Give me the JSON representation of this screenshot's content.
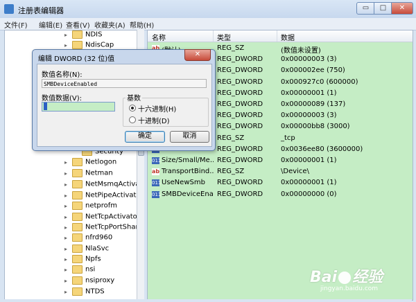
{
  "window": {
    "title": "注册表编辑器",
    "caption_buttons": {
      "minimize": "▭",
      "maximize": "□",
      "close": "✕"
    }
  },
  "menu": [
    "文件(F)",
    "编辑(E)",
    "查看(V)",
    "收藏夹(A)",
    "帮助(H)"
  ],
  "tree": {
    "items": [
      {
        "label": "NDIS",
        "expander": "▸"
      },
      {
        "label": "NdisCap",
        "expander": "▸"
      },
      {
        "label": "Security",
        "expander": ""
      },
      {
        "label": "Netlogon",
        "expander": "▸"
      },
      {
        "label": "Netman",
        "expander": "▸"
      },
      {
        "label": "NetMsmqActivato",
        "expander": "▸"
      },
      {
        "label": "NetPipeActivator",
        "expander": "▸"
      },
      {
        "label": "netprofm",
        "expander": "▸"
      },
      {
        "label": "NetTcpActivator",
        "expander": "▸"
      },
      {
        "label": "NetTcpPortSharin",
        "expander": "▸"
      },
      {
        "label": "nfrd960",
        "expander": "▸"
      },
      {
        "label": "NlaSvc",
        "expander": "▸"
      },
      {
        "label": "Npfs",
        "expander": "▸"
      },
      {
        "label": "nsi",
        "expander": "▸"
      },
      {
        "label": "nsiproxy",
        "expander": "▸"
      },
      {
        "label": "NTDS",
        "expander": "▸"
      }
    ]
  },
  "values_pane": {
    "headers": {
      "name": "名称",
      "type": "类型",
      "data": "数据"
    },
    "rows": [
      {
        "icon": "ab",
        "name": "(默认)",
        "type": "REG_SZ",
        "data": "(数值未设置)"
      },
      {
        "icon": "bin",
        "name": "",
        "type": "REG_DWORD",
        "data": "0x00000003 (3)"
      },
      {
        "icon": "bin",
        "name": "",
        "type": "REG_DWORD",
        "data": "0x000002ee (750)"
      },
      {
        "icon": "bin",
        "name": "",
        "type": "REG_DWORD",
        "data": "0x000927c0 (600000)"
      },
      {
        "icon": "bin",
        "name": "",
        "type": "REG_DWORD",
        "data": "0x00000001 (1)"
      },
      {
        "icon": "bin",
        "name": "",
        "type": "REG_DWORD",
        "data": "0x00000089 (137)"
      },
      {
        "icon": "bin",
        "name": "",
        "type": "REG_DWORD",
        "data": "0x00000003 (3)"
      },
      {
        "icon": "bin",
        "name": "",
        "type": "REG_DWORD",
        "data": "0x00000bb8 (3000)"
      },
      {
        "icon": "ab",
        "name": "",
        "type": "REG_SZ",
        "data": "_tcp"
      },
      {
        "icon": "bin",
        "name": "",
        "type": "REG_DWORD",
        "data": "0x0036ee80 (3600000)"
      },
      {
        "icon": "bin",
        "name": "Size/Small/Me...",
        "type": "REG_DWORD",
        "data": "0x00000001 (1)"
      },
      {
        "icon": "ab",
        "name": "TransportBind...",
        "type": "REG_SZ",
        "data": "\\Device\\"
      },
      {
        "icon": "bin",
        "name": "UseNewSmb",
        "type": "REG_DWORD",
        "data": "0x00000001 (1)"
      },
      {
        "icon": "bin",
        "name": "SMBDeviceEna...",
        "type": "REG_DWORD",
        "data": "0x00000000 (0)"
      }
    ]
  },
  "dialog": {
    "title": "编辑 DWORD (32 位)值",
    "close_glyph": "✕",
    "name_label": "数值名称(N):",
    "name_value": "SMBDeviceEnabled",
    "data_label": "数值数据(V):",
    "data_value": "",
    "base_label": "基数",
    "hex_label": "十六进制(H)",
    "dec_label": "十进制(D)",
    "selected_base": "hex",
    "ok_label": "确定",
    "cancel_label": "取消"
  },
  "watermark": {
    "logo": "Bai",
    "logo_suffix": "经验",
    "url": "jingyan.baidu.com"
  },
  "colors": {
    "values_bg": "#c5edc5",
    "dialog_frame": "#c8d7ec"
  }
}
